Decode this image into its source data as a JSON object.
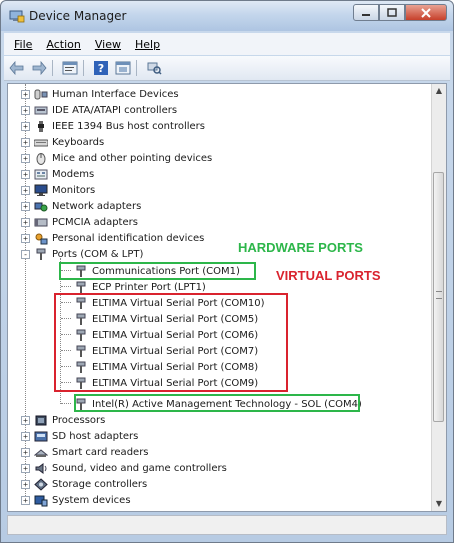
{
  "window": {
    "title": "Device Manager",
    "controls": [
      "min",
      "max",
      "close"
    ]
  },
  "menu": {
    "items": [
      "File",
      "Action",
      "View",
      "Help"
    ]
  },
  "toolbar": {
    "icons": [
      "back-icon",
      "forward-icon",
      "properties-icon",
      "help-icon",
      "update-driver-icon",
      "scan-hardware-icon"
    ]
  },
  "tree": {
    "categories_top": [
      {
        "label": "Human Interface Devices",
        "icon": "hid-icon"
      },
      {
        "label": "IDE ATA/ATAPI controllers",
        "icon": "ide-icon"
      },
      {
        "label": "IEEE 1394 Bus host controllers",
        "icon": "firewire-icon"
      },
      {
        "label": "Keyboards",
        "icon": "keyboard-icon"
      },
      {
        "label": "Mice and other pointing devices",
        "icon": "mouse-icon"
      },
      {
        "label": "Modems",
        "icon": "modem-icon"
      },
      {
        "label": "Monitors",
        "icon": "monitor-icon"
      },
      {
        "label": "Network adapters",
        "icon": "network-icon"
      },
      {
        "label": "PCMCIA adapters",
        "icon": "pcmcia-icon"
      },
      {
        "label": "Personal identification devices",
        "icon": "id-icon"
      },
      {
        "label": "Ports (COM & LPT)",
        "icon": "port-icon",
        "expanded": true
      }
    ],
    "ports": [
      "Communications Port (COM1)",
      "ECP Printer Port (LPT1)",
      "ELTIMA Virtual Serial Port (COM10)",
      "ELTIMA Virtual Serial Port (COM5)",
      "ELTIMA Virtual Serial Port (COM6)",
      "ELTIMA Virtual Serial Port (COM7)",
      "ELTIMA Virtual Serial Port (COM8)",
      "ELTIMA Virtual Serial Port (COM9)",
      "Intel(R) Active Management Technology - SOL (COM4)"
    ],
    "categories_bottom": [
      {
        "label": "Processors",
        "icon": "processor-icon"
      },
      {
        "label": "SD host adapters",
        "icon": "sd-icon"
      },
      {
        "label": "Smart card readers",
        "icon": "smartcard-icon"
      },
      {
        "label": "Sound, video and game controllers",
        "icon": "sound-icon"
      },
      {
        "label": "Storage controllers",
        "icon": "storage-icon"
      },
      {
        "label": "System devices",
        "icon": "system-icon"
      }
    ]
  },
  "annotations": {
    "hardware_label": "HARDWARE PORTS",
    "virtual_label": "VIRTUAL PORTS",
    "green": "#2db64a",
    "red": "#d9232e"
  }
}
